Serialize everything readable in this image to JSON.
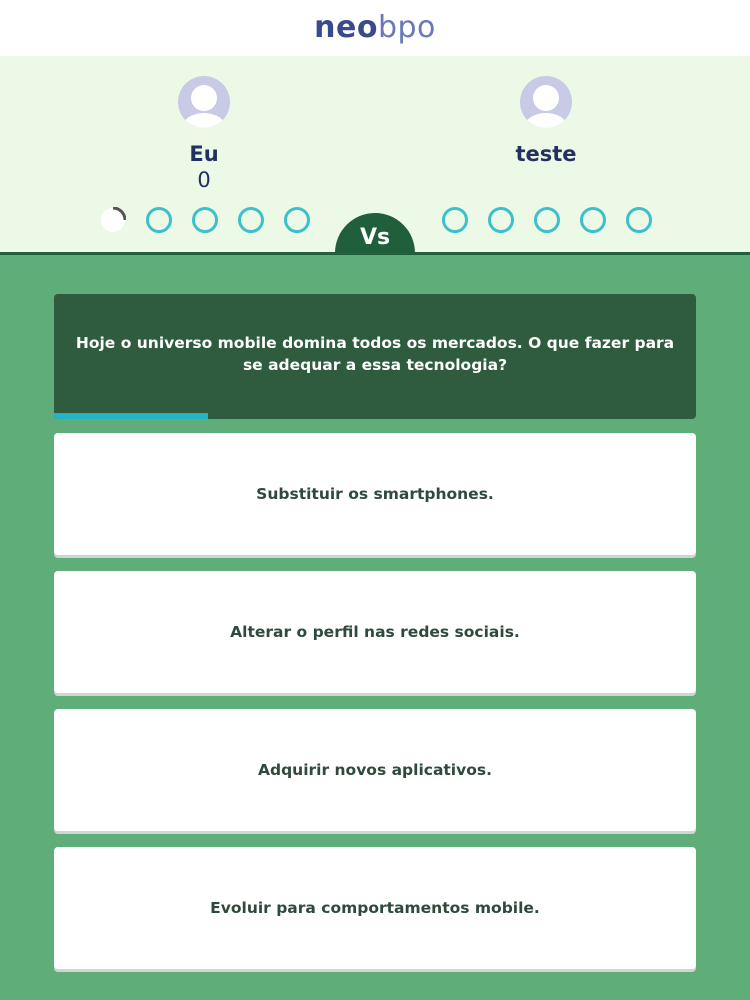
{
  "header": {
    "logo_part1": "neo",
    "logo_part2": "bpo"
  },
  "players": {
    "me": {
      "name": "Eu",
      "score": "0"
    },
    "opponent": {
      "name": "teste"
    }
  },
  "vs_label": "Vs",
  "question": {
    "text": "Hoje o universo mobile domina todos os mercados. O que fazer para se adequar a essa tecnologia?",
    "timer_progress": 0.24
  },
  "answers": [
    {
      "label": "Substituir os smartphones."
    },
    {
      "label": "Alterar o perfil nas redes sociais."
    },
    {
      "label": "Adquirir novos aplicativos."
    },
    {
      "label": "Evoluir para comportamentos mobile."
    }
  ],
  "colors": {
    "brand_dark": "#3a4a8c",
    "brand_light": "#6a78b8",
    "background": "#5fae7a",
    "panel": "#ecf9e6",
    "accent": "#3cc0cc",
    "question_bg": "#2f5b3f"
  }
}
